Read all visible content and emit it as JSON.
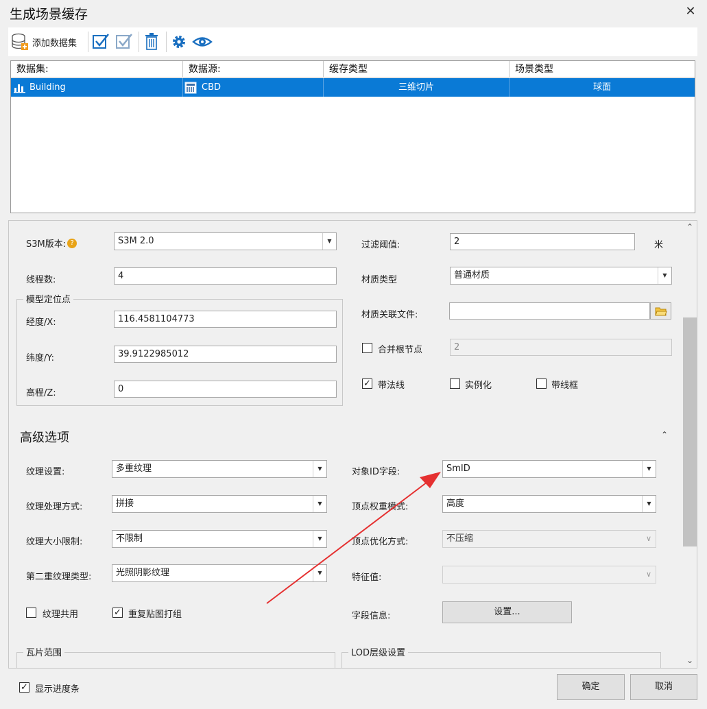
{
  "window": {
    "title": "生成场景缓存",
    "close_glyph": "✕"
  },
  "toolbar": {
    "add_dataset_label": "添加数据集"
  },
  "grid": {
    "columns": [
      "数据集:",
      "数据源:",
      "缓存类型",
      "场景类型"
    ],
    "rows": [
      {
        "dataset": "Building",
        "datasource": "CBD",
        "cache_type": "三维切片",
        "scene_type": "球面"
      }
    ]
  },
  "settings": {
    "s3m_version": {
      "label": "S3M版本:",
      "value": "S3M 2.0"
    },
    "filter_threshold": {
      "label": "过滤阈值:",
      "value": "2",
      "unit": "米"
    },
    "thread_count": {
      "label": "线程数:",
      "value": "4"
    },
    "material_type": {
      "label": "材质类型",
      "value": "普通材质"
    },
    "material_file": {
      "label": "材质关联文件:",
      "value": ""
    },
    "merge_root": {
      "label": "合并根节点",
      "value": "2",
      "checked": false
    },
    "with_normal": {
      "label": "带法线",
      "checked": true
    },
    "instancing": {
      "label": "实例化",
      "checked": false
    },
    "wireframe": {
      "label": "带线框",
      "checked": false
    },
    "model_position": {
      "title": "模型定位点",
      "longitude": {
        "label": "经度/X:",
        "value": "116.4581104773"
      },
      "latitude": {
        "label": "纬度/Y:",
        "value": "39.9122985012"
      },
      "elevation": {
        "label": "高程/Z:",
        "value": "0"
      }
    }
  },
  "advanced": {
    "title": "高级选项",
    "texture_setting": {
      "label": "纹理设置:",
      "value": "多重纹理"
    },
    "texture_process": {
      "label": "纹理处理方式:",
      "value": "拼接"
    },
    "texture_size_limit": {
      "label": "纹理大小限制:",
      "value": "不限制"
    },
    "second_texture_type": {
      "label": "第二重纹理类型:",
      "value": "光照阴影纹理"
    },
    "texture_share": {
      "label": "纹理共用",
      "checked": false
    },
    "repeat_texture_group": {
      "label": "重复贴图打组",
      "checked": true
    },
    "object_id_field": {
      "label": "对象ID字段:",
      "value": "SmID"
    },
    "vertex_weight_mode": {
      "label": "顶点权重模式:",
      "value": "高度"
    },
    "vertex_optimize": {
      "label": "顶点优化方式:",
      "value": "不压缩"
    },
    "feature_value": {
      "label": "特征值:",
      "value": ""
    },
    "field_info": {
      "label": "字段信息:",
      "button": "设置..."
    },
    "tile_range_title": "瓦片范围",
    "lod_title": "LOD层级设置"
  },
  "footer": {
    "show_progress": {
      "label": "显示进度条",
      "checked": true
    },
    "ok_label": "确定",
    "cancel_label": "取消"
  },
  "colors": {
    "selection": "#0a7ad6",
    "icon_blue": "#1a6fc0",
    "arrow": "#e53030"
  }
}
